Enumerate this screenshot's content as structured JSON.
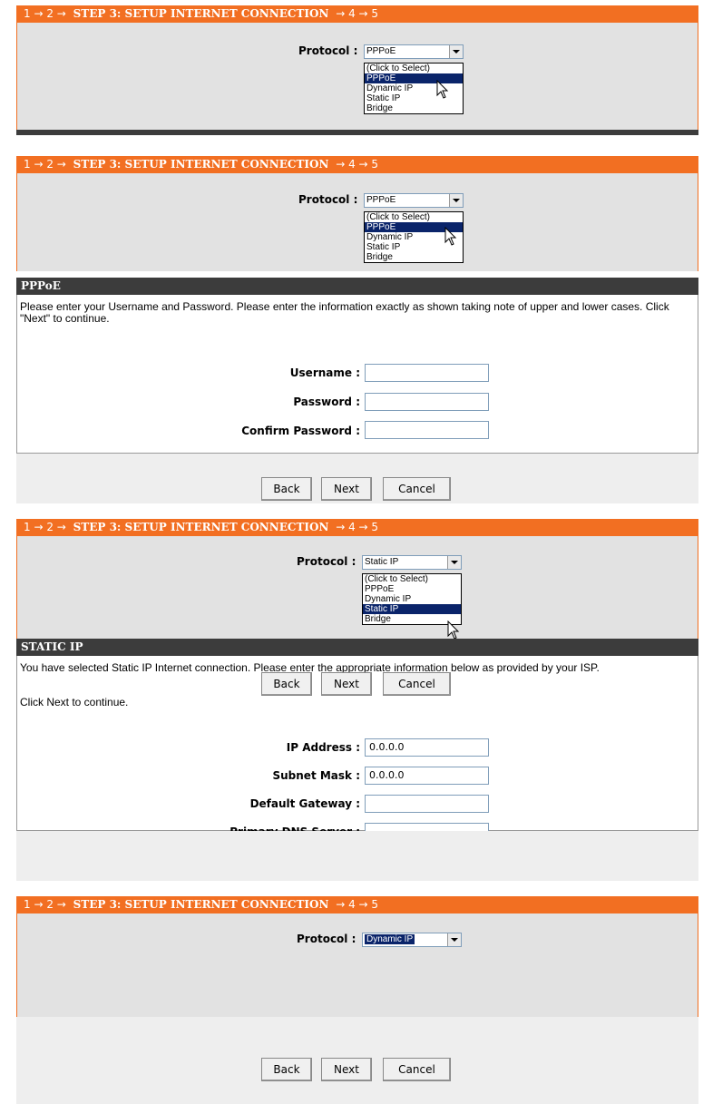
{
  "header": {
    "step_prefix": "1 → 2 → ",
    "step_title": "STEP 3: SETUP INTERNET CONNECTION",
    "step_suffix": " → 4 → 5"
  },
  "protocol_label": "Protocol :",
  "options": [
    "(Click to Select)",
    "PPPoE",
    "Dynamic IP",
    "Static IP",
    "Bridge"
  ],
  "panel1": {
    "selected": "PPPoE"
  },
  "panel2": {
    "selected": "PPPoE"
  },
  "pppoe": {
    "title": "PPPoE",
    "description": "Please enter your Username and Password. Please enter the information exactly as shown taking note of upper and lower cases. Click \"Next\" to continue.",
    "username_label": "Username :",
    "password_label": "Password :",
    "confirm_label": "Confirm Password :",
    "username_value": "",
    "password_value": "",
    "confirm_value": ""
  },
  "panel3": {
    "selected": "Static IP"
  },
  "static": {
    "title": "STATIC IP",
    "description": "You have selected Static IP Internet connection. Please enter the appropriate information below as provided by your ISP.",
    "note": "Click Next to continue.",
    "ip_label": "IP Address :",
    "mask_label": "Subnet Mask :",
    "gateway_label": "Default Gateway :",
    "dns_label": "Primary DNS Server :",
    "ip_value": "0.0.0.0",
    "mask_value": "0.0.0.0",
    "gateway_value": "",
    "dns_value": ""
  },
  "panel4": {
    "selected": "Dynamic IP"
  },
  "buttons": {
    "back": "Back",
    "next": "Next",
    "cancel": "Cancel"
  }
}
